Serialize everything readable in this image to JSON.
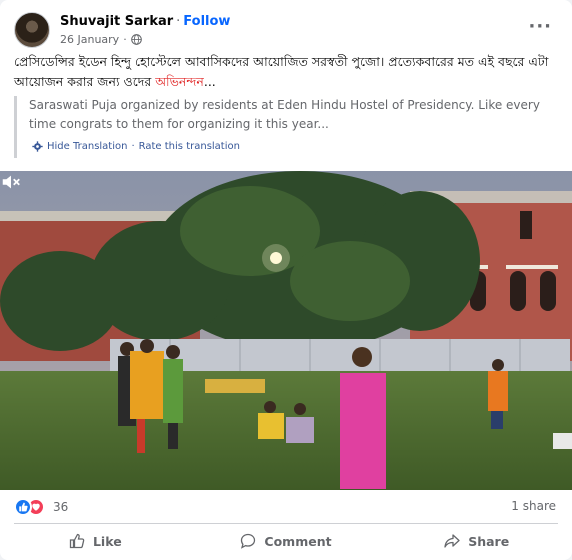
{
  "post": {
    "author": "Shuvajit Sarkar",
    "follow_label": "Follow",
    "separator": "·",
    "date": "26 January",
    "text_main": "প্রেসিডেন্সির ইডেন হিন্দু হোস্টেলে আবাসিকদের আয়োজিত সরস্বতী পুজো। প্রত্যেকবারের মত এই বছরে এটা আয়োজন করার জন্য ওদের ",
    "text_highlight": "অভিনন্দন",
    "text_tail": "...",
    "translation": {
      "text": "Saraswati Puja organized by residents at Eden Hindu Hostel of Presidency. Like every time congrats to them for organizing it this year...",
      "hide_label": "Hide Translation",
      "link_separator": "·",
      "rate_label": "Rate this translation"
    }
  },
  "video": {
    "scene": "hostel-lawn-evening",
    "mute_icon": "speaker-muted-icon"
  },
  "engagement": {
    "reaction_count": "36",
    "share_count": "1 share"
  },
  "actions": [
    {
      "label": "Like",
      "icon": "thumbs-up-icon"
    },
    {
      "label": "Comment",
      "icon": "comment-icon"
    },
    {
      "label": "Share",
      "icon": "share-icon"
    }
  ],
  "colors": {
    "follow": "#0866ff",
    "highlight": "#e02424",
    "like_reaction": "#1877f2",
    "love_reaction": "#f33e58",
    "secondary_text": "#65676b"
  }
}
